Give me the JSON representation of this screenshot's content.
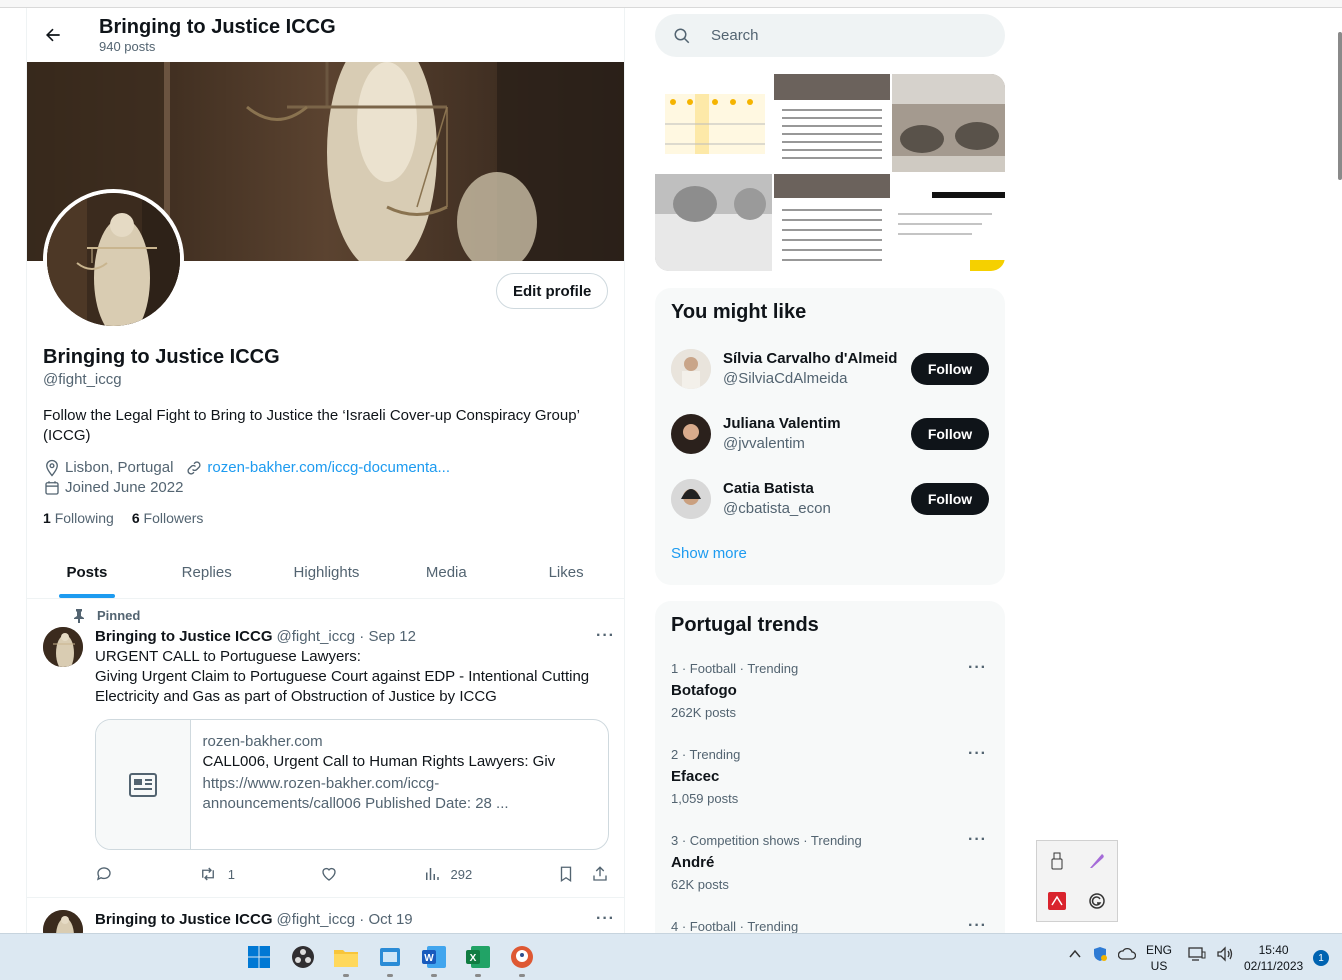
{
  "header": {
    "title": "Bringing to Justice ICCG",
    "post_count": "940 posts"
  },
  "profile": {
    "edit_label": "Edit profile",
    "name": "Bringing to Justice ICCG",
    "handle": "@fight_iccg",
    "bio": "Follow the Legal Fight to Bring to Justice the ‘Israeli Cover-up Conspiracy Group’ (ICCG)",
    "location": "Lisbon, Portugal",
    "website": "rozen-bakher.com/iccg-documenta...",
    "joined": "Joined June 2022",
    "following_count": "1",
    "following_label": "Following",
    "followers_count": "6",
    "followers_label": "Followers"
  },
  "tabs": [
    "Posts",
    "Replies",
    "Highlights",
    "Media",
    "Likes"
  ],
  "pinned_label": "Pinned",
  "tweets": [
    {
      "name": "Bringing to Justice ICCG",
      "handle": "@fight_iccg · Sep 12",
      "text_line1": "URGENT CALL to Portuguese Lawyers:",
      "text_line2": "Giving Urgent Claim to Portuguese Court against EDP - Intentional Cutting Electricity and Gas as part of Obstruction of Justice by ICCG",
      "card": {
        "domain": "rozen-bakher.com",
        "title": "CALL006, Urgent Call to Human Rights Lawyers: Giv",
        "desc": "https://www.rozen-bakher.com/iccg-announcements/call006 Published Date: 28 ..."
      },
      "retweets": "1",
      "views": "292"
    },
    {
      "name": "Bringing to Justice ICCG",
      "handle": "@fight_iccg · Oct 19"
    }
  ],
  "search": {
    "placeholder": "Search"
  },
  "who_to_follow": {
    "title": "You might like",
    "follow_label": "Follow",
    "users": [
      {
        "name": "Sílvia Carvalho d'Almeid",
        "handle": "@SilviaCdAlmeida"
      },
      {
        "name": "Juliana Valentim",
        "handle": "@jvvalentim"
      },
      {
        "name": "Catia Batista",
        "handle": "@cbatista_econ"
      }
    ],
    "show_more": "Show more"
  },
  "trends": {
    "title": "Portugal trends",
    "items": [
      {
        "meta": "1 · Football · Trending",
        "name": "Botafogo",
        "count": "262K posts"
      },
      {
        "meta": "2 · Trending",
        "name": "Efacec",
        "count": "1,059 posts"
      },
      {
        "meta": "3 · Competition shows · Trending",
        "name": "André",
        "count": "62K posts"
      },
      {
        "meta": "4 · Football · Trending"
      }
    ]
  },
  "taskbar": {
    "lang_top": "ENG",
    "lang_bottom": "US",
    "time": "15:40",
    "date": "02/11/2023",
    "notifications": "1"
  },
  "colors": {
    "accent": "#1d9bf0",
    "text": "#0f1419",
    "secondary": "#536471"
  }
}
